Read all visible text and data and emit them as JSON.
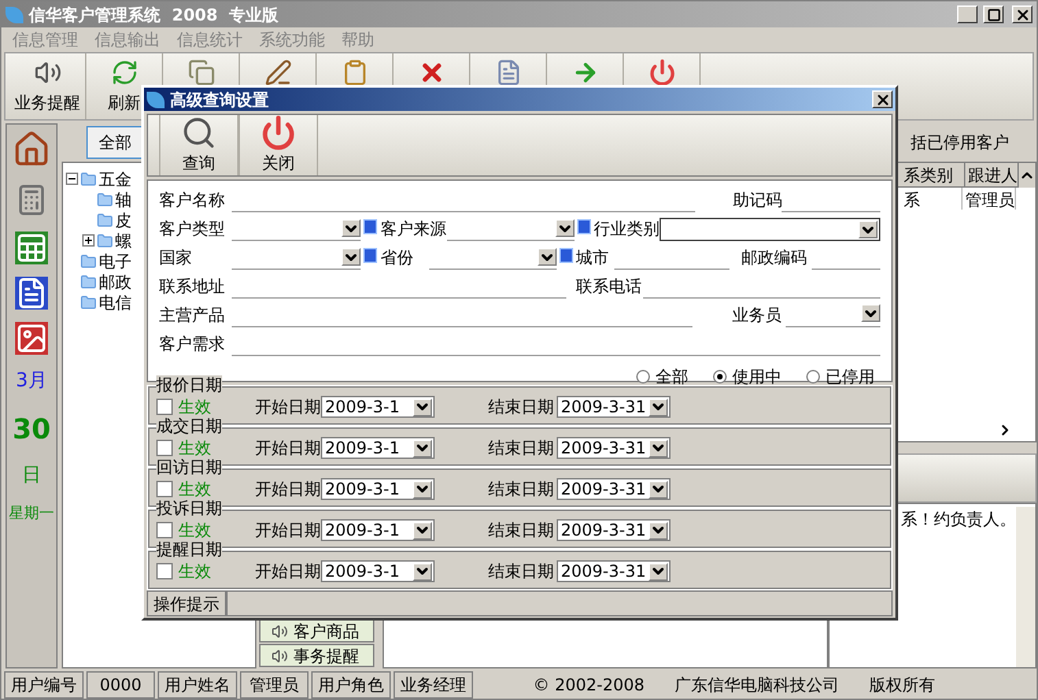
{
  "window": {
    "title": "信华客户管理系统  2008  专业版"
  },
  "menu": [
    "信息管理",
    "信息输出",
    "信息统计",
    "系统功能",
    "帮助"
  ],
  "toolbar": [
    {
      "kind": "speaker",
      "label": "业务提醒"
    },
    {
      "kind": "refresh",
      "label": "刷新"
    },
    {
      "kind": "copy"
    },
    {
      "kind": "edit"
    },
    {
      "kind": "clipboard"
    },
    {
      "kind": "delete"
    },
    {
      "kind": "list"
    },
    {
      "kind": "arrow"
    },
    {
      "kind": "power"
    }
  ],
  "calendar": {
    "month": "3月",
    "day": "30",
    "unit": "日",
    "weekday": "星期一"
  },
  "filter_button": "全部",
  "tree": [
    {
      "label": "五金",
      "expanded": true,
      "children": [
        {
          "label": "轴"
        },
        {
          "label": "皮"
        },
        {
          "label": "螺",
          "expanded": false
        }
      ]
    },
    {
      "label": "电子"
    },
    {
      "label": "邮政"
    },
    {
      "label": "电信"
    }
  ],
  "include_stopped": "括已停用客户",
  "table": {
    "columns": [
      "系类别",
      "跟进人"
    ],
    "rows": [
      [
        "系",
        "管理员"
      ]
    ]
  },
  "note": "系！约负责人。",
  "nav_buttons": [
    "客户商品",
    "事务提醒"
  ],
  "status_bar": [
    "用户编号",
    "0000",
    "用户姓名",
    "管理员",
    "用户角色",
    "业务经理",
    "© 2002-2008",
    "广东信华电脑科技公司",
    "版权所有"
  ],
  "dialog": {
    "title": "高级查询设置",
    "toolbar": [
      {
        "kind": "search",
        "label": "查询"
      },
      {
        "kind": "close",
        "label": "关闭"
      }
    ],
    "form_rows": [
      [
        {
          "label": "客户名称",
          "kind": "text"
        },
        {
          "label": "助记码",
          "kind": "text"
        }
      ],
      [
        {
          "label": "客户类型",
          "kind": "lookup"
        },
        {
          "label": "客户来源",
          "kind": "lookup"
        },
        {
          "label": "行业类别",
          "kind": "select"
        }
      ],
      [
        {
          "label": "国家",
          "kind": "lookup"
        },
        {
          "label": "省份",
          "kind": "lookup"
        },
        {
          "label": "城市",
          "kind": "text"
        },
        {
          "label": "邮政编码",
          "kind": "text"
        }
      ],
      [
        {
          "label": "联系地址",
          "kind": "text"
        },
        {
          "label": "联系电话",
          "kind": "text"
        }
      ],
      [
        {
          "label": "主营产品",
          "kind": "text"
        },
        {
          "label": "业务员",
          "kind": "combo"
        }
      ],
      [
        {
          "label": "客户需求",
          "kind": "text"
        }
      ]
    ],
    "status_options": [
      {
        "label": "全部",
        "selected": false
      },
      {
        "label": "使用中",
        "selected": true
      },
      {
        "label": "已停用",
        "selected": false
      }
    ],
    "date_groups": [
      {
        "title": "报价日期",
        "enable_label": "生效",
        "checked": false,
        "start_label": "开始日期",
        "start": "2009-3-1",
        "end_label": "结束日期",
        "end": "2009-3-31"
      },
      {
        "title": "成交日期",
        "enable_label": "生效",
        "checked": false,
        "start_label": "开始日期",
        "start": "2009-3-1",
        "end_label": "结束日期",
        "end": "2009-3-31"
      },
      {
        "title": "回访日期",
        "enable_label": "生效",
        "checked": false,
        "start_label": "开始日期",
        "start": "2009-3-1",
        "end_label": "结束日期",
        "end": "2009-3-31"
      },
      {
        "title": "投诉日期",
        "enable_label": "生效",
        "checked": false,
        "start_label": "开始日期",
        "start": "2009-3-1",
        "end_label": "结束日期",
        "end": "2009-3-31"
      },
      {
        "title": "提醒日期",
        "enable_label": "生效",
        "checked": false,
        "start_label": "开始日期",
        "start": "2009-3-1",
        "end_label": "结束日期",
        "end": "2009-3-31"
      }
    ],
    "status": "操作提示"
  }
}
